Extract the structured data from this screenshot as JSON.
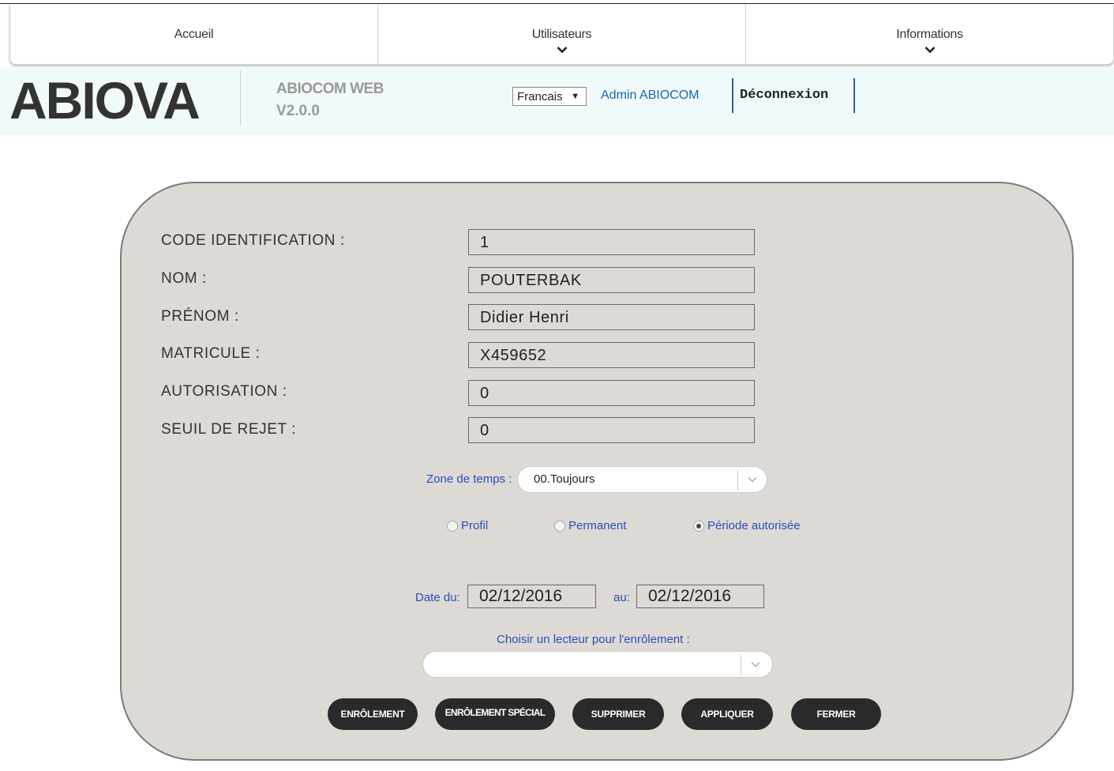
{
  "nav": {
    "items": [
      {
        "label": "Accueil",
        "has_dropdown": false
      },
      {
        "label": "Utilisateurs",
        "has_dropdown": true
      },
      {
        "label": "Informations",
        "has_dropdown": true
      }
    ]
  },
  "header": {
    "logo": "ABIOVA",
    "app_name": "ABIOCOM WEB",
    "app_version": "V2.0.0",
    "language": "Francais",
    "user": "Admin ABIOCOM",
    "logout": "Déconnexion"
  },
  "form": {
    "fields": [
      {
        "label": "CODE IDENTIFICATION :",
        "value": "1"
      },
      {
        "label": "NOM :",
        "value": "POUTERBAK"
      },
      {
        "label": "PRÉNOM :",
        "value": "Didier Henri"
      },
      {
        "label": "MATRICULE :",
        "value": "X459652"
      },
      {
        "label": "AUTORISATION :",
        "value": "0"
      },
      {
        "label": "SEUIL DE REJET :",
        "value": "0"
      }
    ],
    "time_zone": {
      "label": "Zone de temps :",
      "value": "00.Toujours"
    },
    "access_mode": {
      "options": [
        {
          "label": "Profil",
          "selected": false
        },
        {
          "label": "Permanent",
          "selected": false
        },
        {
          "label": "Période autorisée",
          "selected": true
        }
      ]
    },
    "dates": {
      "from_label": "Date du:",
      "from_value": "02/12/2016",
      "to_label": "au:",
      "to_value": "02/12/2016"
    },
    "reader": {
      "label": "Choisir un lecteur pour l'enrôlement :",
      "value": ""
    },
    "buttons": {
      "enroll": "ENRÔLEMENT",
      "special_enroll": "ENRÔLEMENT SPÉCIAL",
      "delete": "SUPPRIMER",
      "apply": "APPLIQUER",
      "close": "FERMER"
    }
  },
  "colors": {
    "accent_blue": "#2a4fb8",
    "button_dark": "#2a2a2a",
    "card_bg": "#ddd9d5",
    "header_bg": "#f1fafa"
  }
}
